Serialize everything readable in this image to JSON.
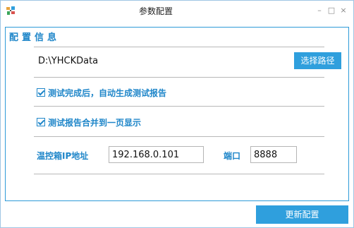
{
  "window": {
    "title": "参数配置",
    "controls": {
      "minimize": "–",
      "maximize": "□",
      "close": "×"
    }
  },
  "panel": {
    "title": "配置信息",
    "path_value": "D:\\YHCKData",
    "choose_path_label": "选择路径",
    "checkboxes": [
      {
        "label": "测试完成后，自动生成测试报告",
        "checked": true
      },
      {
        "label": "测试报告合并到一页显示",
        "checked": true
      }
    ],
    "ip_label": "温控箱IP地址",
    "ip_value": "192.168.0.101",
    "port_label": "端口",
    "port_value": "8888"
  },
  "footer": {
    "update_label": "更新配置"
  },
  "colors": {
    "accent": "#2f9fdd",
    "label_blue": "#1f86c9",
    "border": "#2d9ad8"
  }
}
